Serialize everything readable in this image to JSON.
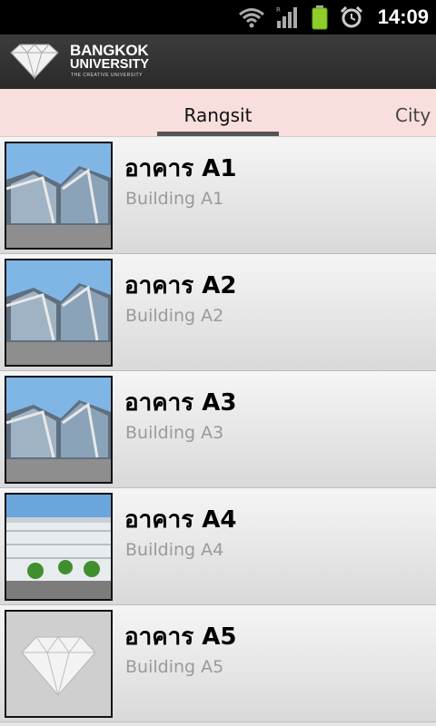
{
  "status_bar": {
    "time": "14:09",
    "icons": [
      "wifi-icon",
      "signal-icon",
      "battery-icon",
      "alarm-icon"
    ]
  },
  "header": {
    "logo_line1": "BANGKOK",
    "logo_line2": "UNIVERSITY",
    "logo_tagline": "THE CREATIVE UNIVERSITY"
  },
  "tabs": [
    {
      "label": "Rangsit",
      "selected": true
    },
    {
      "label": "City",
      "selected": false
    }
  ],
  "buildings": [
    {
      "title": "อาคาร A1",
      "subtitle": "Building A1",
      "image": "building-photo"
    },
    {
      "title": "อาคาร  A2",
      "subtitle": "Building A2",
      "image": "building-photo"
    },
    {
      "title": "อาคาร  A3",
      "subtitle": "Building A3",
      "image": "building-photo"
    },
    {
      "title": "อาคาร A4",
      "subtitle": "Building A4",
      "image": "building-photo-long"
    },
    {
      "title": "อาคาร A5",
      "subtitle": "Building A5",
      "image": "diamond-placeholder"
    }
  ],
  "colors": {
    "tab_background": "#f9dede",
    "tab_indicator": "#555555",
    "header_background": "#333333"
  }
}
